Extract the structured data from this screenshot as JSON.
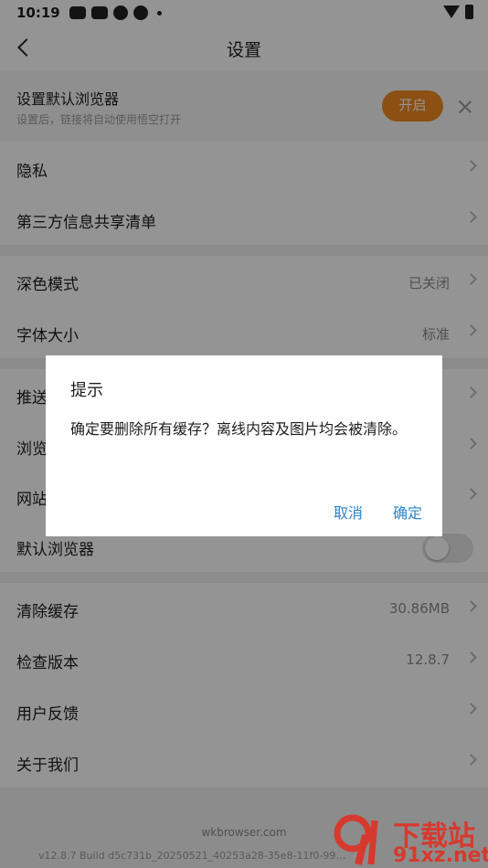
{
  "status_bar": {
    "time": "10:19"
  },
  "header": {
    "title": "设置"
  },
  "banner": {
    "title": "设置默认浏览器",
    "subtitle": "设置后，链接将自动使用悟空打开",
    "button_label": "开启"
  },
  "rows": {
    "privacy": {
      "label": "隐私"
    },
    "third_party": {
      "label": "第三方信息共享清单"
    },
    "dark_mode": {
      "label": "深色模式",
      "value": "已关闭"
    },
    "font_size": {
      "label": "字体大小",
      "value": "标准"
    },
    "push": {
      "label": "推送"
    },
    "browse": {
      "label": "浏览"
    },
    "site": {
      "label": "网站"
    },
    "default_browser": {
      "label": "默认浏览器"
    },
    "clear_cache": {
      "label": "清除缓存",
      "value": "30.86MB"
    },
    "check_version": {
      "label": "检查版本",
      "value": "12.8.7"
    },
    "feedback": {
      "label": "用户反馈"
    },
    "about": {
      "label": "关于我们"
    }
  },
  "footer": {
    "brand": "wkbrowser.com",
    "build": "v12.8.7 Build d5c731b_20250521_40253a28-35e8-11f0-99…"
  },
  "dialog": {
    "title": "提示",
    "message": "确定要删除所有缓存？离线内容及图片均会被清除。",
    "cancel_label": "取消",
    "confirm_label": "确定"
  },
  "watermark": {
    "line1": "下载站",
    "line2": "91xz.net"
  },
  "colors": {
    "accent": "#f08a1f",
    "link": "#2a86c8",
    "watermark": "#d63a2e"
  }
}
